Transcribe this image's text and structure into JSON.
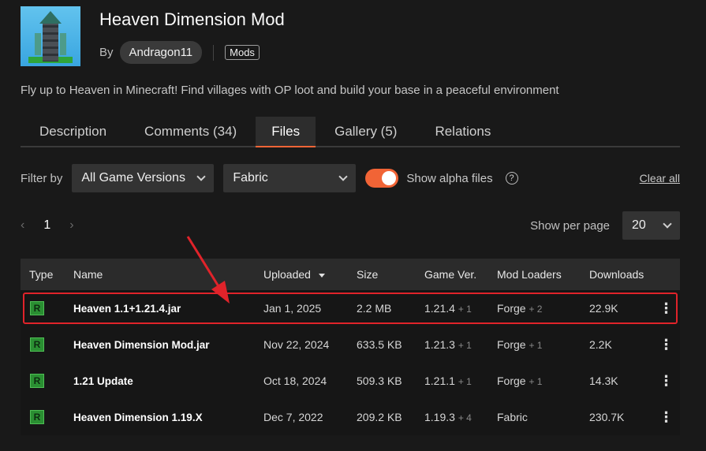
{
  "project": {
    "title": "Heaven Dimension Mod",
    "by_label": "By",
    "author": "Andragon11",
    "category": "Mods",
    "summary": "Fly up to Heaven in Minecraft! Find villages with OP loot and build your base in a peaceful environment"
  },
  "tabs": [
    {
      "label": "Description"
    },
    {
      "label": "Comments (34)"
    },
    {
      "label": "Files",
      "active": true
    },
    {
      "label": "Gallery (5)"
    },
    {
      "label": "Relations"
    }
  ],
  "filters": {
    "filter_by_label": "Filter by",
    "game_version": "All Game Versions",
    "loader": "Fabric",
    "show_alpha_label": "Show alpha files",
    "show_alpha_on": true,
    "help_glyph": "?",
    "clear_all": "Clear all"
  },
  "pagination": {
    "prev": "‹",
    "page": "1",
    "next": "›",
    "per_page_label": "Show per page",
    "per_page_value": "20"
  },
  "table": {
    "headers": {
      "type": "Type",
      "name": "Name",
      "uploaded": "Uploaded",
      "size": "Size",
      "game_ver": "Game Ver.",
      "mod_loaders": "Mod Loaders",
      "downloads": "Downloads"
    },
    "rows": [
      {
        "type": "R",
        "name": "Heaven 1.1+1.21.4.jar",
        "uploaded": "Jan 1, 2025",
        "size": "2.2 MB",
        "game_ver": "1.21.4",
        "game_ver_extra": "+ 1",
        "loader": "Forge",
        "loader_extra": "+ 2",
        "downloads": "22.9K"
      },
      {
        "type": "R",
        "name": "Heaven Dimension Mod.jar",
        "uploaded": "Nov 22, 2024",
        "size": "633.5 KB",
        "game_ver": "1.21.3",
        "game_ver_extra": "+ 1",
        "loader": "Forge",
        "loader_extra": "+ 1",
        "downloads": "2.2K"
      },
      {
        "type": "R",
        "name": "1.21 Update",
        "uploaded": "Oct 18, 2024",
        "size": "509.3 KB",
        "game_ver": "1.21.1",
        "game_ver_extra": "+ 1",
        "loader": "Forge",
        "loader_extra": "+ 1",
        "downloads": "14.3K"
      },
      {
        "type": "R",
        "name": "Heaven Dimension 1.19.X",
        "uploaded": "Dec 7, 2022",
        "size": "209.2 KB",
        "game_ver": "1.19.3",
        "game_ver_extra": "+ 4",
        "loader": "Fabric",
        "loader_extra": "",
        "downloads": "230.7K"
      }
    ],
    "menu_glyph": "⋮"
  },
  "colors": {
    "accent": "#f16436",
    "release_badge": "#2a8f32",
    "highlight": "#e0232a"
  }
}
